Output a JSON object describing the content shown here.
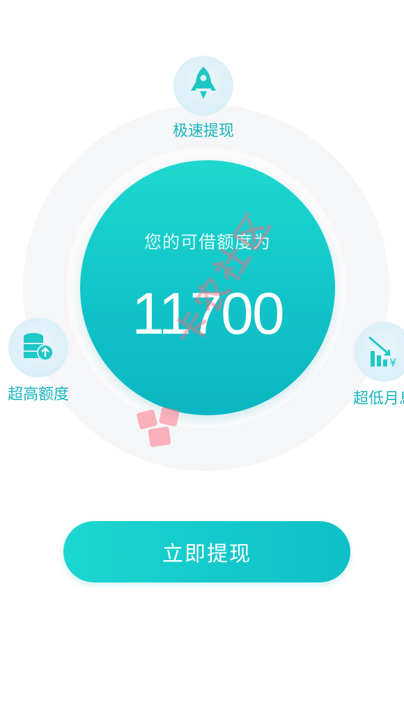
{
  "features": {
    "top": {
      "label": "极速提现",
      "icon": "rocket-icon"
    },
    "left": {
      "label": "超高额度",
      "icon": "coins-stack-icon"
    },
    "right": {
      "label": "超低月息",
      "icon": "bar-chart-yen-icon"
    }
  },
  "credit": {
    "title": "您的可借额度为",
    "amount": "11700"
  },
  "withdraw_button": {
    "label": "立即提现"
  },
  "watermark": {
    "text": "卡农社区"
  },
  "colors": {
    "accent": "#13c8cb",
    "feature_text": "#17b5bf",
    "bubble_bg": "#dbeff7",
    "watermark": "#ff697d"
  }
}
